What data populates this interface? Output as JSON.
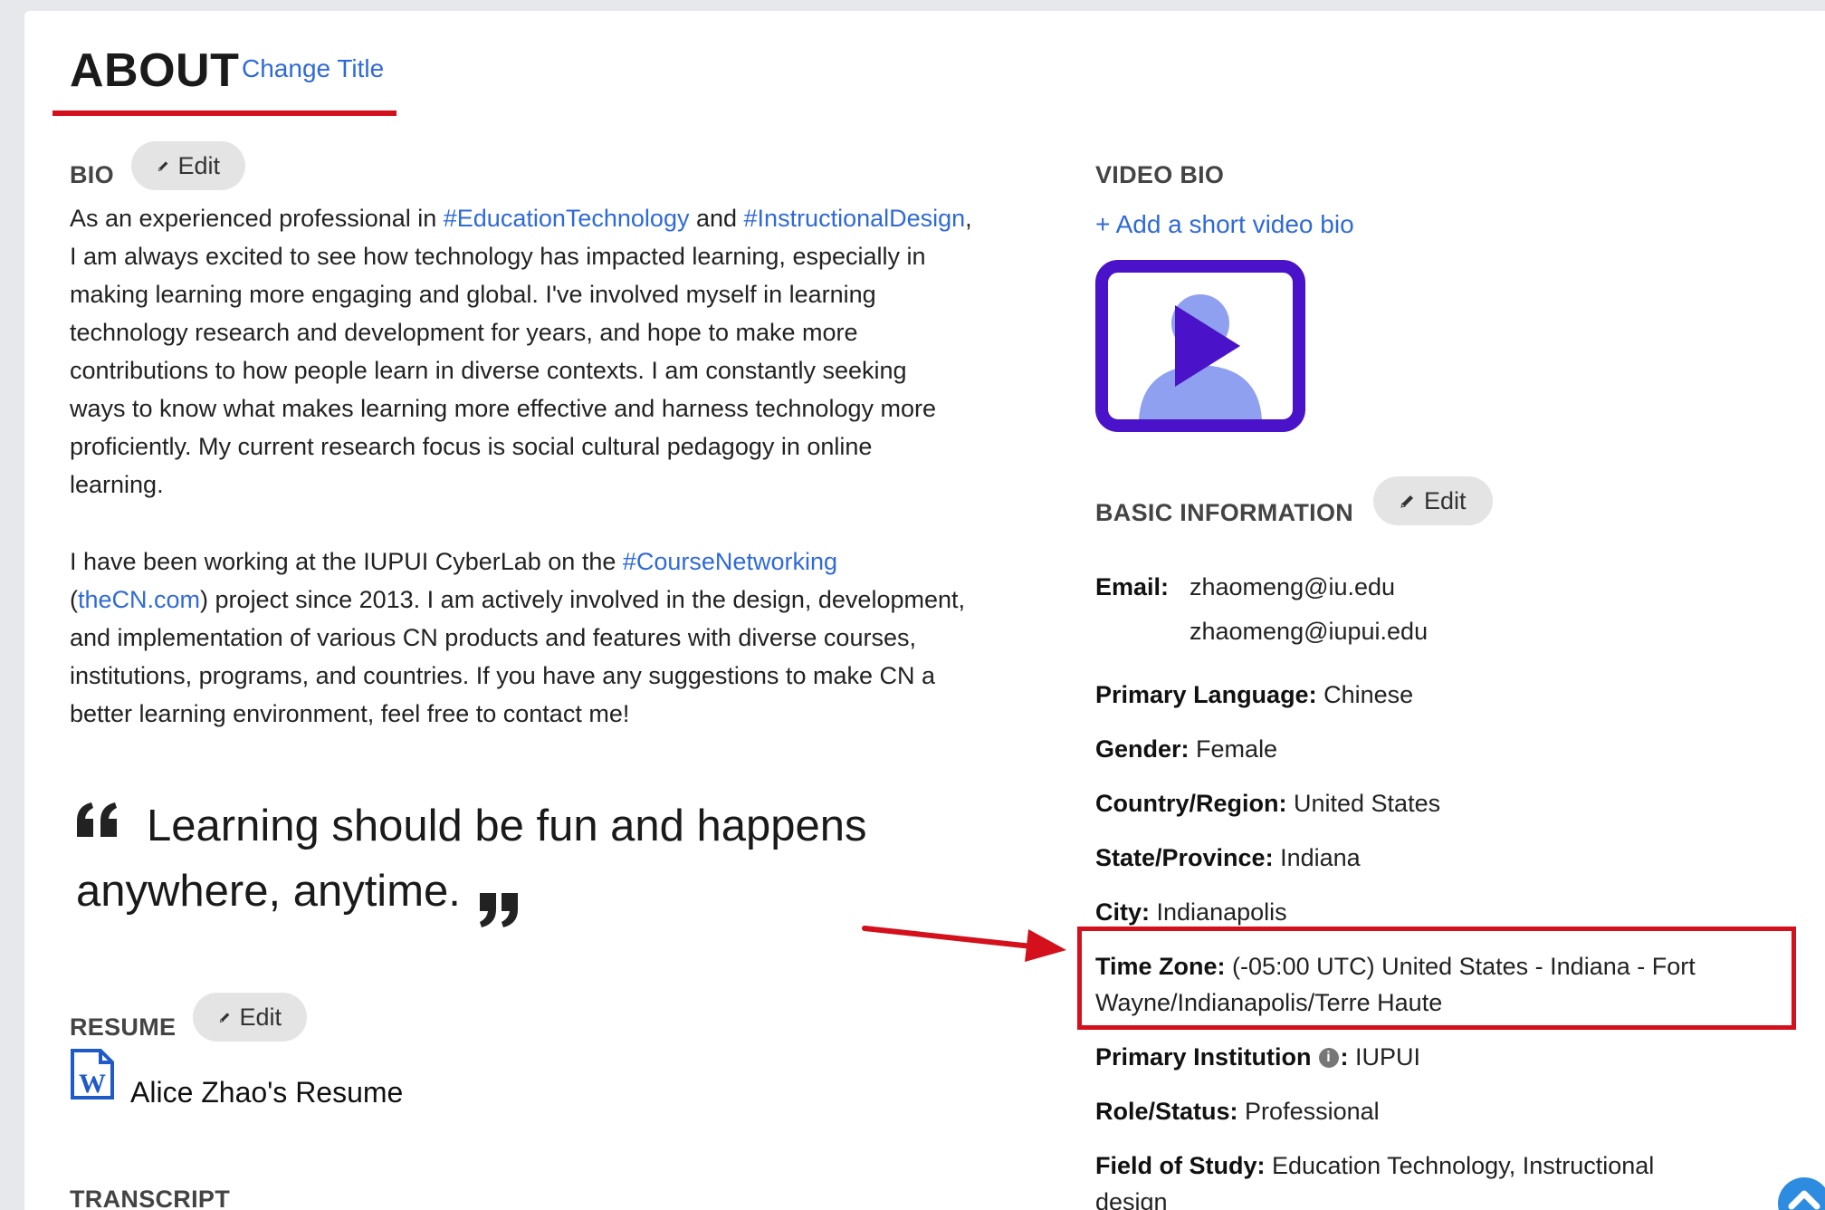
{
  "header": {
    "title": "ABOUT",
    "change_title": "Change Title"
  },
  "bio": {
    "label": "BIO",
    "edit_label": "Edit",
    "p1": {
      "t1": "As an experienced professional in ",
      "tag1": "#EducationTechnology",
      "t2": " and ",
      "tag2": "#InstructionalDesign",
      "t3": ",",
      "lines": [
        "I am always excited to see how technology has impacted learning, especially in",
        "making learning more engaging and global. I've involved myself in learning",
        "technology research and development for years, and hope to make more",
        "contributions to how people learn in diverse contexts. I am constantly seeking",
        "ways to know what makes learning more effective and harness technology more",
        "proficiently. My current research focus is social cultural pedagogy in online",
        "learning."
      ]
    },
    "p2": {
      "t1": "I have been working at the IUPUI CyberLab on the ",
      "tag": "#CourseNetworking",
      "open": "(",
      "site": "theCN.com",
      "t2": ") project since 2013. I am actively involved in the design, development,",
      "lines": [
        "and implementation of various CN products and features with diverse courses,",
        "institutions, programs, and countries. If you have any suggestions to make CN a",
        "better learning environment, feel free to contact me!"
      ]
    }
  },
  "quote": {
    "line1": "Learning should be fun and happens",
    "line2": "anywhere, anytime."
  },
  "resume": {
    "label": "RESUME",
    "edit_label": "Edit",
    "file_name": "Alice Zhao's Resume",
    "icon": "word-document-icon"
  },
  "transcript": {
    "label": "TRANSCRIPT"
  },
  "video_bio": {
    "label": "VIDEO BIO",
    "add_link": "+ Add a short video bio",
    "icon": "video-play-icon"
  },
  "basic_info": {
    "label": "BASIC INFORMATION",
    "edit_label": "Edit",
    "email": {
      "label": "Email:",
      "values": [
        "zhaomeng@iu.edu",
        "zhaomeng@iupui.edu"
      ]
    },
    "primary_language": {
      "label": "Primary Language:",
      "value": "Chinese"
    },
    "gender": {
      "label": "Gender:",
      "value": "Female"
    },
    "country": {
      "label": "Country/Region:",
      "value": "United States"
    },
    "state": {
      "label": "State/Province:",
      "value": "Indiana"
    },
    "city": {
      "label": "City:",
      "value": "Indianapolis"
    },
    "time_zone": {
      "label": "Time Zone:",
      "value1": "(-05:00 UTC) United States - Indiana - Fort",
      "value2": "Wayne/Indianapolis/Terre Haute"
    },
    "institution": {
      "label": "Primary Institution",
      "colon": ":",
      "value": "IUPUI"
    },
    "role": {
      "label": "Role/Status:",
      "value": "Professional"
    },
    "field": {
      "label": "Field of Study:",
      "value1": "Education Technology, Instructional",
      "value2": "design"
    }
  },
  "colors": {
    "link": "#2f6ad9",
    "accent_red": "#d3101c",
    "video_purple": "#4a12c9",
    "video_light": "#8fa0f0"
  }
}
